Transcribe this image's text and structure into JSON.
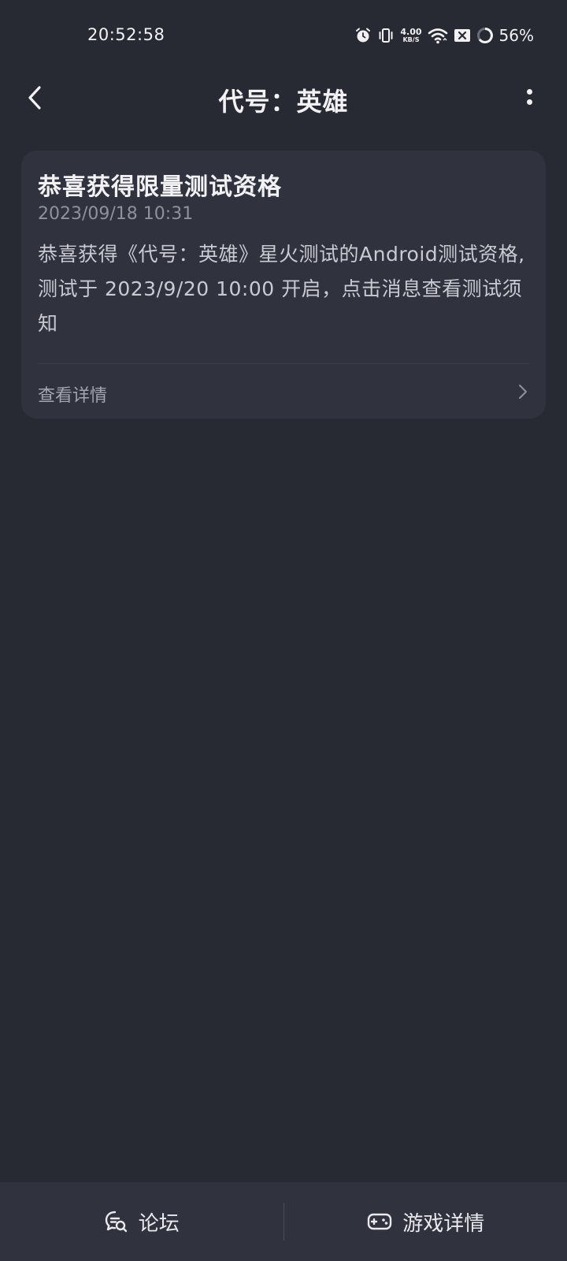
{
  "status_bar": {
    "time": "20:52:58",
    "net_speed_value": "4.00",
    "net_speed_unit": "KB/S",
    "battery": "56%"
  },
  "header": {
    "title": "代号：英雄"
  },
  "message_card": {
    "title": "恭喜获得限量测试资格",
    "date": "2023/09/18 10:31",
    "body": "恭喜获得《代号：英雄》星火测试的Android测试资格,测试于 2023/9/20 10:00 开启，点击消息查看测试须知",
    "details_label": "查看详情"
  },
  "bottom_bar": {
    "forum_label": "论坛",
    "game_details_label": "游戏详情"
  },
  "colors": {
    "background": "#282a33",
    "card": "#30323d",
    "text_primary": "#f2f2f5",
    "text_secondary": "#8f919c"
  }
}
